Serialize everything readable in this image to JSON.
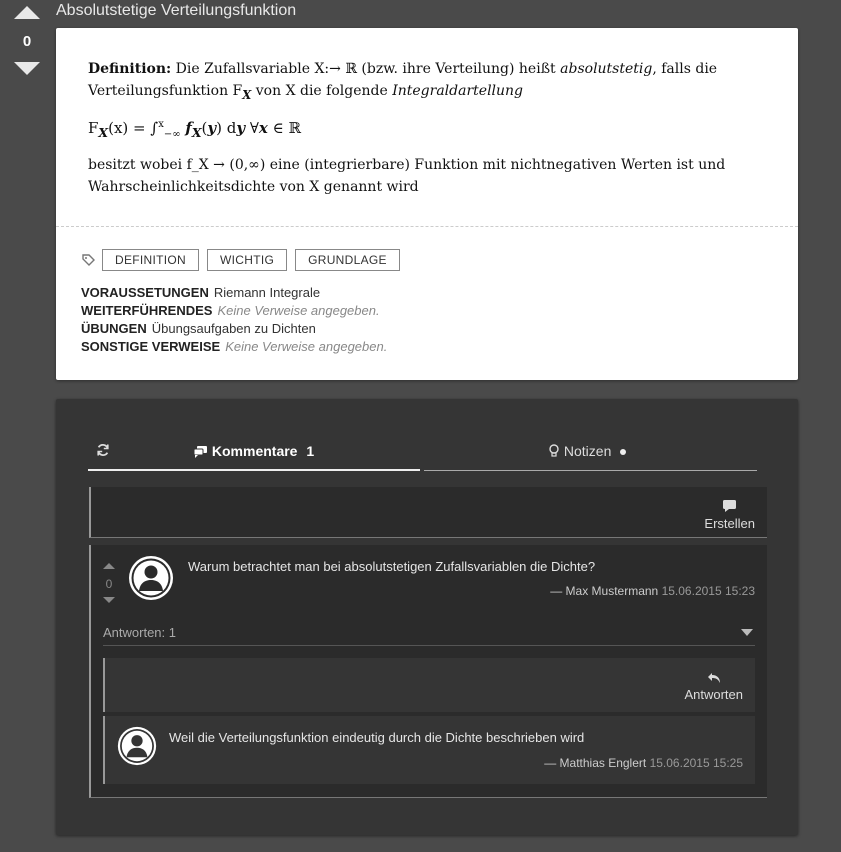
{
  "question": {
    "title": "Absolutstetige Verteilungsfunktion",
    "votes": "0"
  },
  "definition": {
    "line1_label": "Definition:",
    "line1_a": " Die Zufallsvariable X:→ ℝ (bzw. ihre Verteilung) heißt ",
    "line1_em": "absolutstetig",
    "line1_b": ", falls die",
    "line2_a": "Verteilungsfunktion F",
    "line2_sub": "X",
    "line2_b": " von X die folgende ",
    "line2_em": "Integraldartellung",
    "formula": "F_X(x) = ∫_{−∞}^{x} f_X(y) dy ∀x ∈ ℝ",
    "line4": "besitzt wobei f_X → (0,∞) eine (integrierbare) Funktion mit nichtnegativen Werten ist und",
    "line5": "Wahrscheinlichkeitsdichte von X genannt wird"
  },
  "tags": [
    "DEFINITION",
    "WICHTIG",
    "GRUNDLAGE"
  ],
  "meta": {
    "voraussetzungen_label": "VORAUSSETUNGEN",
    "voraussetzungen_value": "Riemann Integrale",
    "weiterfuehrendes_label": "WEITERFÜHRENDES",
    "weiterfuehrendes_value": "Keine Verweise angegeben.",
    "uebungen_label": "ÜBUNGEN",
    "uebungen_value": "Übungsaufgaben zu Dichten",
    "sonstige_label": "SONSTIGE VERWEISE",
    "sonstige_value": "Keine Verweise angegeben."
  },
  "tabs": {
    "comments_label": "Kommentare",
    "comments_count": "1",
    "notes_label": "Notizen"
  },
  "create_label": "Erstellen",
  "comment": {
    "votes": "0",
    "text": "Warum betrachtet man bei absolutstetigen Zufallsvariablen die Dichte?",
    "author": "—  Max Mustermann",
    "date": "15.06.2015 15:23",
    "answers_label": "Antworten: 1"
  },
  "reply_label": "Antworten",
  "reply": {
    "text": "Weil die Verteilungsfunktion eindeutig durch die Dichte beschrieben wird",
    "author": "— Matthias Englert",
    "date": "15.06.2015 15:25"
  },
  "colors": {
    "background": "#4a4a4a",
    "panel": "#353535",
    "card": "#ffffff"
  }
}
